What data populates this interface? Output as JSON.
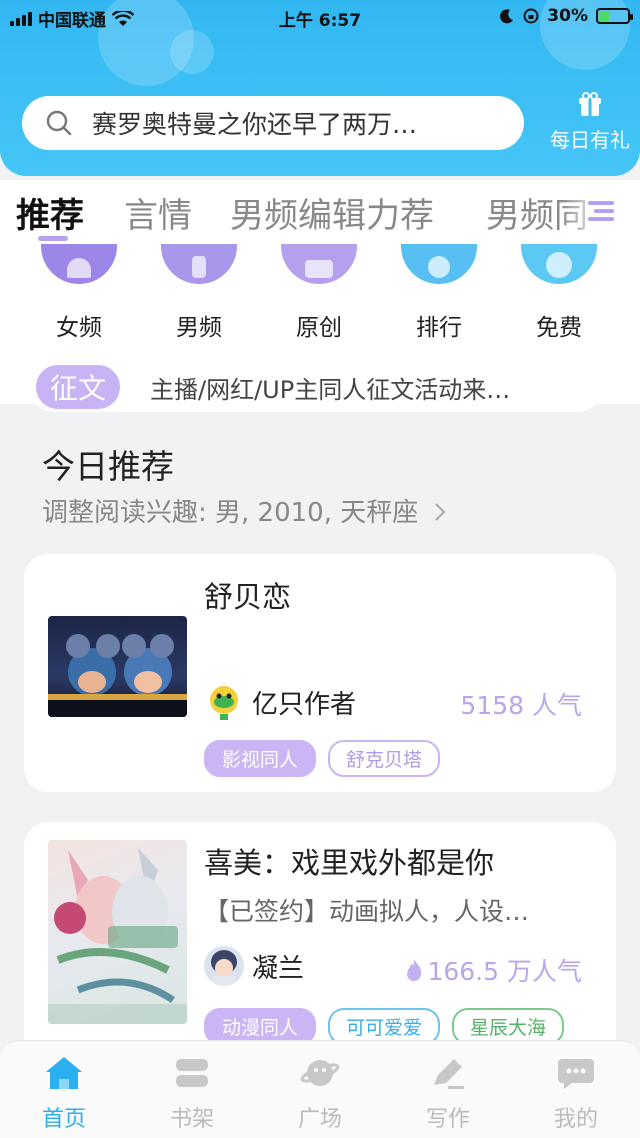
{
  "status_bar": {
    "carrier": "中国联通",
    "time": "上午 6:57",
    "battery": "30%"
  },
  "search": {
    "placeholder": "赛罗奥特曼之你还早了两万…",
    "icon": "search-icon"
  },
  "gift": {
    "label": "每日有礼",
    "icon": "gift-icon"
  },
  "tabs": [
    {
      "label": "推荐",
      "active": true
    },
    {
      "label": "言情",
      "active": false
    },
    {
      "label": "男频编辑力荐",
      "active": false
    },
    {
      "label": "男频同",
      "active": false
    }
  ],
  "categories": [
    {
      "label": "女频",
      "color": "#9c86e8"
    },
    {
      "label": "男频",
      "color": "#a997ec"
    },
    {
      "label": "原创",
      "color": "#b6a0ee"
    },
    {
      "label": "排行",
      "color": "#58bff3"
    },
    {
      "label": "免费",
      "color": "#5cc8f4"
    }
  ],
  "notice": {
    "tag": "征文",
    "text": "主播/网红/UP主同人征文活动来…"
  },
  "section": {
    "title": "今日推荐",
    "subtitle": "调整阅读兴趣: 男, 2010, 天秤座"
  },
  "books": [
    {
      "title": "舒贝恋",
      "description": "",
      "author": "亿只作者",
      "popularity": "5158 人气",
      "tags": [
        "影视同人",
        "舒克贝塔"
      ]
    },
    {
      "title": "喜美：戏里戏外都是你",
      "description": "【已签约】动画拟人，人设…",
      "author": "凝兰",
      "popularity": "166.5 万人气",
      "tags": [
        "动漫同人",
        "可可爱爱",
        "星辰大海"
      ]
    }
  ],
  "bottom_nav": [
    {
      "label": "首页",
      "icon": "home-icon",
      "active": true
    },
    {
      "label": "书架",
      "icon": "bookshelf-icon",
      "active": false
    },
    {
      "label": "广场",
      "icon": "planet-icon",
      "active": false
    },
    {
      "label": "写作",
      "icon": "pen-icon",
      "active": false
    },
    {
      "label": "我的",
      "icon": "chat-bubble-icon",
      "active": false
    }
  ],
  "colors": {
    "header": "#32b7f2",
    "accent_purple": "#b9a5ee",
    "active_nav": "#2bb0ef"
  }
}
